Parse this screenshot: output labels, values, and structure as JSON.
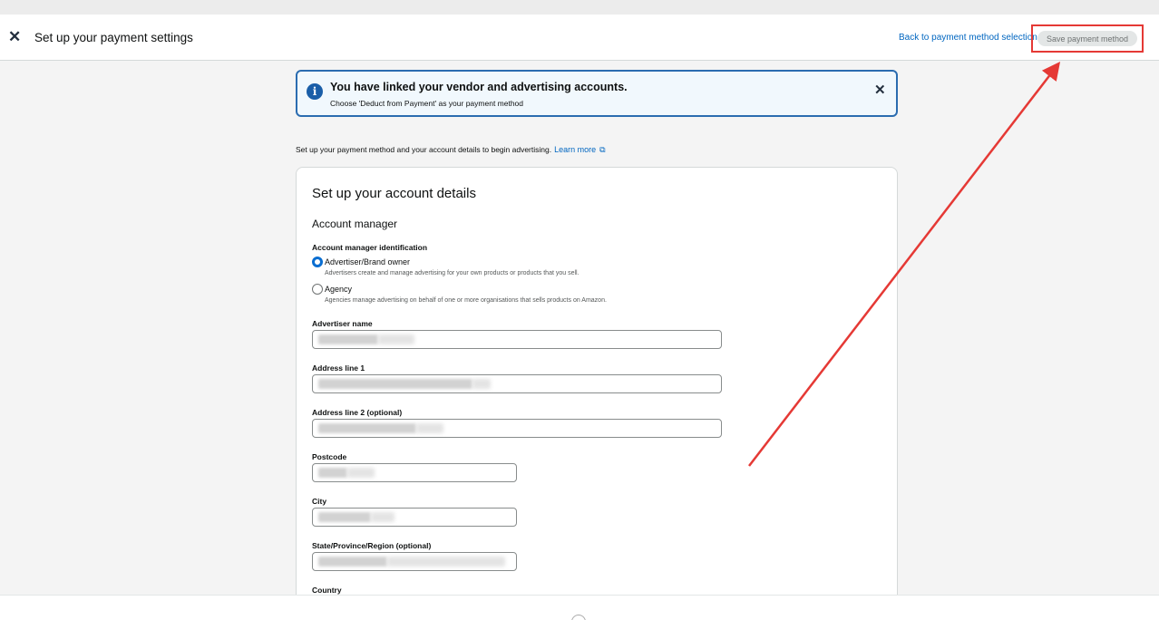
{
  "header": {
    "title": "Set up your payment settings",
    "back_link": "Back to payment method selection",
    "save_button": "Save payment method"
  },
  "alert": {
    "title": "You have linked your vendor and advertising accounts.",
    "message": "Choose 'Deduct from Payment' as your payment method"
  },
  "intro": {
    "text": "Set up your payment method and your account details to begin advertising.",
    "learn_more": "Learn more"
  },
  "account": {
    "heading": "Set up your account details",
    "subheading": "Account manager",
    "identification_label": "Account manager identification",
    "options": [
      {
        "label": "Advertiser/Brand owner",
        "help": "Advertisers create and manage advertising for your own products or products that you sell.",
        "selected": true
      },
      {
        "label": "Agency",
        "help": "Agencies manage advertising on behalf of one or more organisations that sells products on Amazon.",
        "selected": false
      }
    ],
    "fields": {
      "advertiser_name": "Advertiser name",
      "address_line_1": "Address line 1",
      "address_line_2": "Address line 2 (optional)",
      "postcode": "Postcode",
      "city": "City",
      "state": "State/Province/Region (optional)",
      "country": "Country"
    }
  },
  "colors": {
    "annotation": "#e53935",
    "link": "#0066c0",
    "radio_selected": "#0a6ed1",
    "alert_border": "#2b6cb0"
  }
}
